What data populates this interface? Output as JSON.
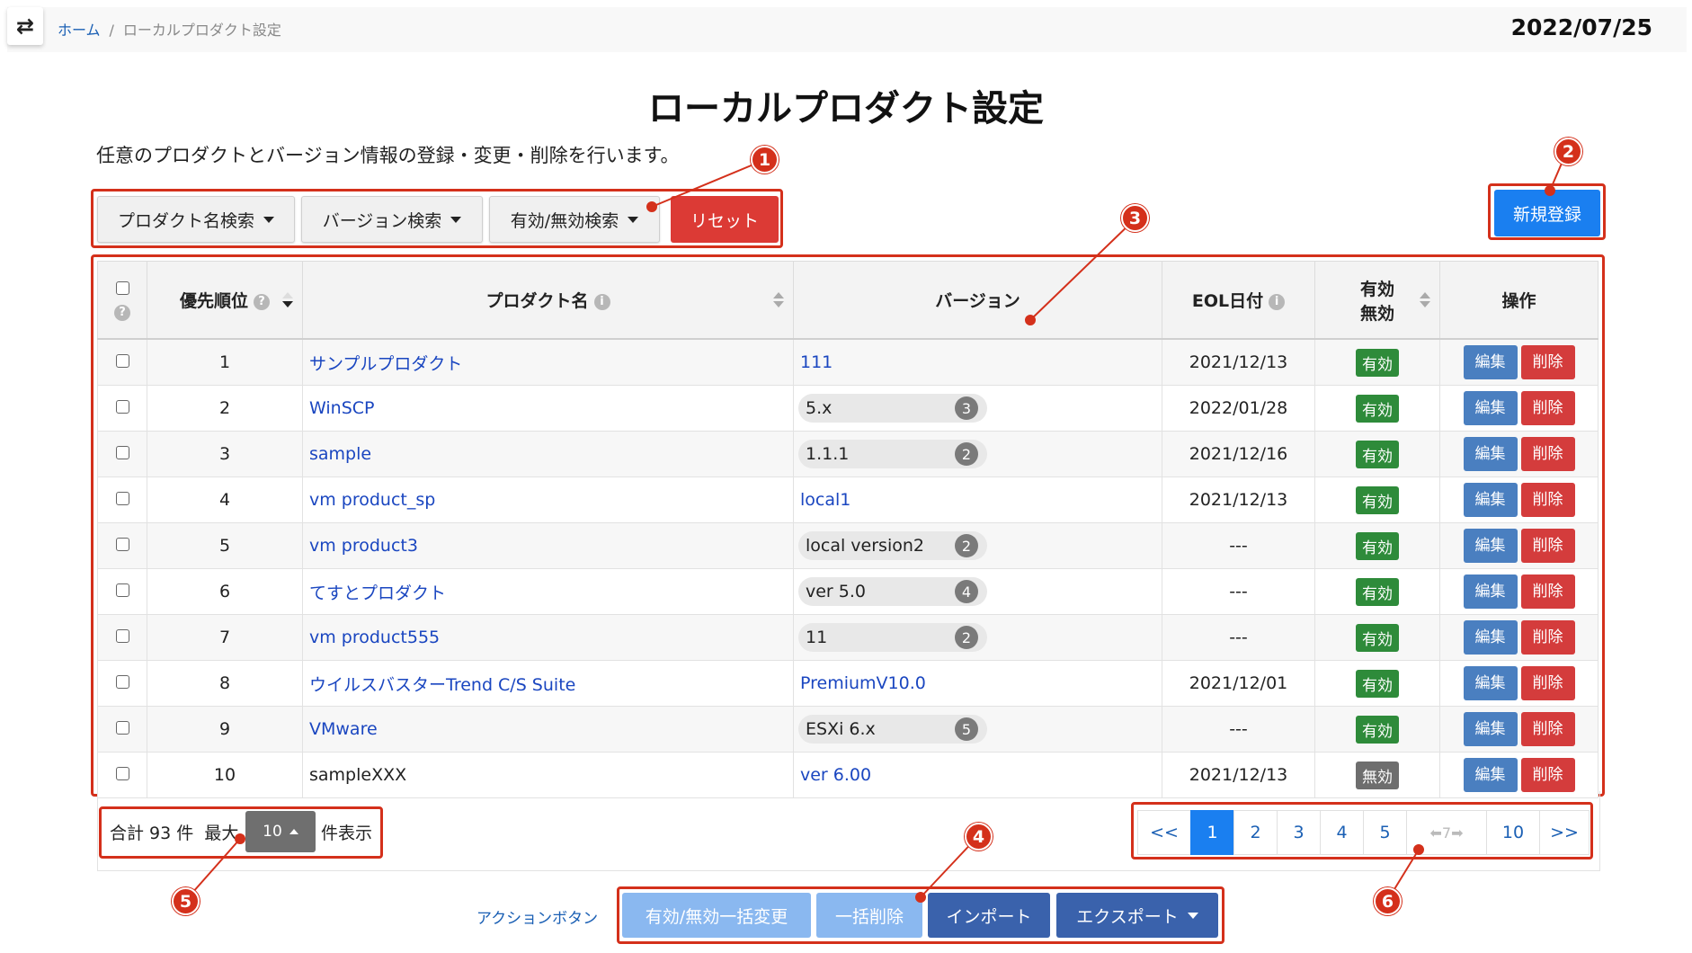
{
  "header": {
    "toggle_icon": "swap-arrows-icon",
    "breadcrumb": {
      "home": "ホーム",
      "separator": "/",
      "current": "ローカルプロダクト設定"
    },
    "date": "2022/07/25"
  },
  "page": {
    "title": "ローカルプロダクト設定",
    "subtitle": "任意のプロダクトとバージョン情報の登録・変更・削除を行います。"
  },
  "filters": {
    "product_search": "プロダクト名検索",
    "version_search": "バージョン検索",
    "status_search": "有効/無効検索",
    "reset": "リセット"
  },
  "new_button": "新規登録",
  "annotations": [
    "1",
    "2",
    "3",
    "4",
    "5",
    "6"
  ],
  "table": {
    "headers": {
      "priority": "優先順位",
      "product": "プロダクト名",
      "version": "バージョン",
      "eol": "EOL日付",
      "status_line1": "有効",
      "status_line2": "無効",
      "actions": "操作"
    },
    "help_glyph": "?",
    "info_glyph": "i",
    "rows": [
      {
        "priority": "1",
        "product": "サンプルプロダクト",
        "product_link": true,
        "version": "111",
        "version_count": "",
        "eol": "2021/12/13",
        "status": "有効",
        "active": true
      },
      {
        "priority": "2",
        "product": "WinSCP",
        "product_link": true,
        "version": "5.x",
        "version_count": "3",
        "eol": "2022/01/28",
        "status": "有効",
        "active": true
      },
      {
        "priority": "3",
        "product": "sample",
        "product_link": true,
        "version": "1.1.1",
        "version_count": "2",
        "eol": "2021/12/16",
        "status": "有効",
        "active": true
      },
      {
        "priority": "4",
        "product": "vm product_sp",
        "product_link": true,
        "version": "local1",
        "version_count": "",
        "eol": "2021/12/13",
        "status": "有効",
        "active": true
      },
      {
        "priority": "5",
        "product": "vm product3",
        "product_link": true,
        "version": "local version2",
        "version_count": "2",
        "eol": "---",
        "status": "有効",
        "active": true
      },
      {
        "priority": "6",
        "product": "てすとプロダクト",
        "product_link": true,
        "version": "ver 5.0",
        "version_count": "4",
        "eol": "---",
        "status": "有効",
        "active": true
      },
      {
        "priority": "7",
        "product": "vm product555",
        "product_link": true,
        "version": "11",
        "version_count": "2",
        "eol": "---",
        "status": "有効",
        "active": true
      },
      {
        "priority": "8",
        "product": "ウイルスバスターTrend C/S Suite",
        "product_link": true,
        "version": "PremiumV10.0",
        "version_count": "",
        "eol": "2021/12/01",
        "status": "有効",
        "active": true
      },
      {
        "priority": "9",
        "product": "VMware",
        "product_link": true,
        "version": "ESXi 6.x",
        "version_count": "5",
        "eol": "---",
        "status": "有効",
        "active": true
      },
      {
        "priority": "10",
        "product": "sampleXXX",
        "product_link": false,
        "version": "ver 6.00",
        "version_count": "",
        "eol": "2021/12/13",
        "status": "無効",
        "active": false
      }
    ],
    "edit_label": "編集",
    "delete_label": "削除"
  },
  "footer": {
    "total": "合計 93 件",
    "max_label": "最大",
    "per_page": "10",
    "per_page_suffix": "件表示"
  },
  "pagination": {
    "prev": "<<",
    "pages": [
      "1",
      "2",
      "3",
      "4",
      "5"
    ],
    "ellipsis": "⬅7➡",
    "last": "10",
    "next": ">>",
    "current": "1"
  },
  "bottom_actions": {
    "label": "アクションボタン",
    "bulk_status": "有効/無効一括変更",
    "bulk_delete": "一括削除",
    "import": "インポート",
    "export": "エクスポート"
  },
  "colors": {
    "annotation": "#d4301b",
    "primary": "#1a7ff0",
    "danger": "#dc3a35",
    "success": "#2e8b3a",
    "link": "#1a46c0"
  }
}
